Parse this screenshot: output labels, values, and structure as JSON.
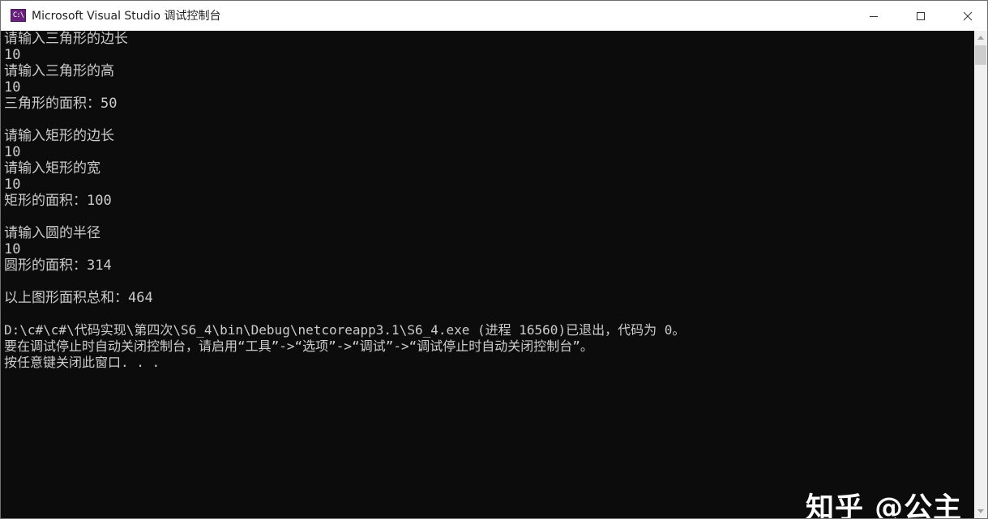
{
  "window": {
    "title": "Microsoft Visual Studio 调试控制台",
    "app_icon_text": "C:\\",
    "app_icon": "visual-studio-console-icon",
    "controls": {
      "minimize_icon": "minimize-icon",
      "maximize_icon": "maximize-icon",
      "close_icon": "close-icon"
    }
  },
  "console": {
    "lines": [
      "请输入三角形的边长",
      "10",
      "请输入三角形的高",
      "10",
      "三角形的面积：50",
      "",
      "请输入矩形的边长",
      "10",
      "请输入矩形的宽",
      "10",
      "矩形的面积：100",
      "",
      "请输入圆的半径",
      "10",
      "圆形的面积：314",
      "",
      "以上图形面积总和：464",
      "",
      "D:\\c#\\c#\\代码实现\\第四次\\S6_4\\bin\\Debug\\netcoreapp3.1\\S6_4.exe (进程 16560)已退出，代码为 0。",
      "要在调试停止时自动关闭控制台，请启用“工具”->“选项”->“调试”->“调试停止时自动关闭控制台”。",
      "按任意键关闭此窗口. . ."
    ]
  },
  "scrollbar": {
    "up_icon": "scroll-up-arrow-icon",
    "down_icon": "scroll-down-arrow-icon"
  },
  "watermark": {
    "text": "知乎 @公主"
  },
  "colors": {
    "console_background": "#0c0c0c",
    "console_text": "#cccccc",
    "titlebar_background": "#ffffff"
  }
}
